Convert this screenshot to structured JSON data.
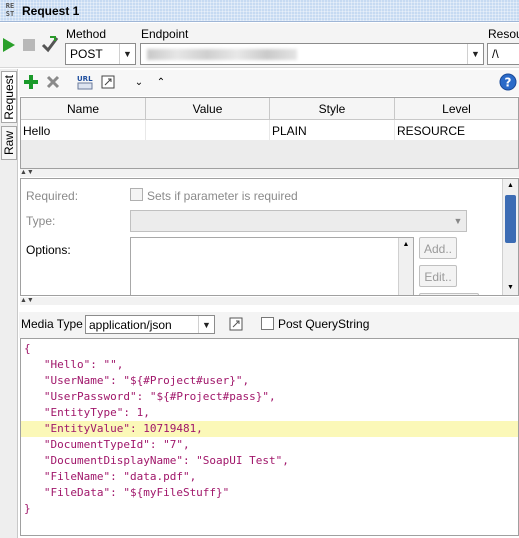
{
  "window": {
    "icon_text": "RE\nST",
    "title": "Request 1"
  },
  "toolbar": {
    "method_label": "Method",
    "method_value": "POST",
    "endpoint_label": "Endpoint",
    "endpoint_value": "",
    "resource_label": "Resou",
    "resource_value": "/\\"
  },
  "side_tabs": [
    "Request",
    "Raw"
  ],
  "params": {
    "columns": [
      "Name",
      "Value",
      "Style",
      "Level"
    ],
    "rows": [
      {
        "name": "Hello",
        "value": "",
        "style": "PLAIN",
        "level": "RESOURCE"
      }
    ]
  },
  "details": {
    "required_label": "Required:",
    "required_hint": "Sets if parameter is required",
    "type_label": "Type:",
    "options_label": "Options:",
    "add_button": "Add..",
    "edit_button": "Edit.."
  },
  "media": {
    "label": "Media Type",
    "value": "application/json",
    "post_querystring_label": "Post QueryString"
  },
  "editor": {
    "lines": [
      "{",
      "   \"Hello\": \"\",",
      "   \"UserName\": \"${#Project#user}\",",
      "   \"UserPassword\": \"${#Project#pass}\",",
      "   \"EntityType\": 1,",
      "   \"EntityValue\": 10719481,",
      "   \"DocumentTypeId\": \"7\",",
      "   \"DocumentDisplayName\": \"SoapUI Test\",",
      "   \"FileName\": \"data.pdf\",",
      "   \"FileData\": \"${myFileStuff}\"",
      "}"
    ],
    "highlighted_line": 5
  },
  "colors": {
    "code_string": "#a0166a",
    "highlight": "#fbf8b8",
    "run_green": "#2aa02a",
    "add_green": "#1a9a2a"
  }
}
